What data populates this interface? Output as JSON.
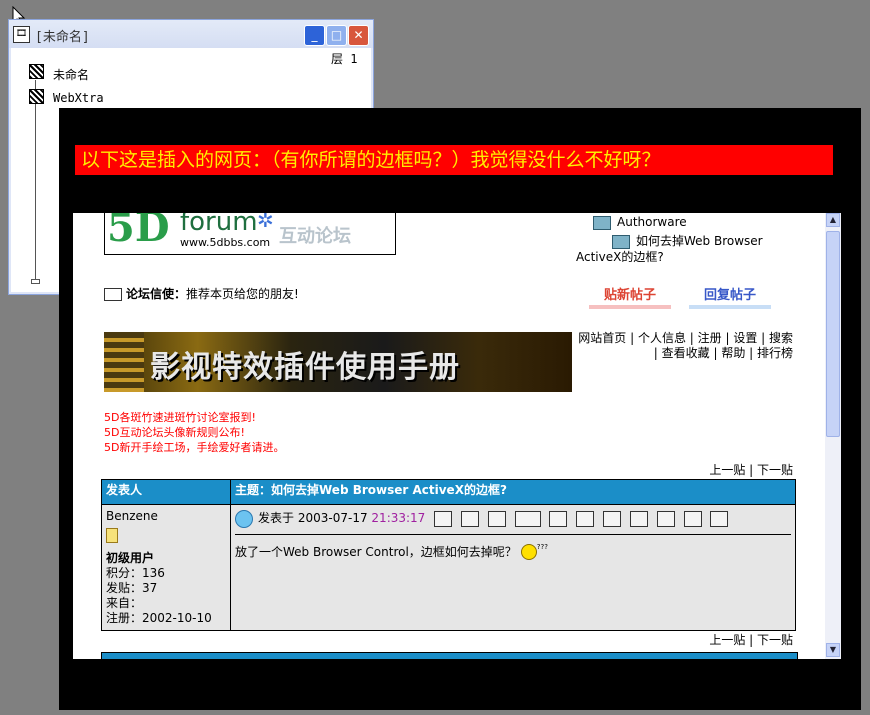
{
  "colors": {
    "desktop": "#808080",
    "banner_bg": "#ff0000",
    "banner_text": "#ffef00",
    "table_header": "#1b8ec8",
    "post_time": "#a020a0"
  },
  "small_window": {
    "title": "[未命名]",
    "app_icon": "director-icon",
    "layer_label": "层 1",
    "nodes": [
      {
        "label": "未命名",
        "icon": "sprite-node-icon"
      },
      {
        "label": "WebXtra",
        "icon": "xtra-node-icon"
      }
    ]
  },
  "banner": {
    "text": "以下这是插入的网页：（有你所谓的边框吗？）我觉得没什么不好呀？"
  },
  "forum": {
    "logo": {
      "brand": "5D",
      "word": "forum",
      "url": "www.5dbbs.com",
      "tagline": "互动论坛"
    },
    "breadcrumb": [
      {
        "label": "Authorware"
      },
      {
        "label": "如何去掉Web Browser ActiveX的边框?"
      }
    ],
    "messenger": {
      "label": "论坛信使：",
      "text": "推荐本页给您的朋友!"
    },
    "buttons": {
      "new_post": "贴新帖子",
      "reply": "回复帖子"
    },
    "ad_banner_text": "影视特效插件使用手册",
    "nav_links": "网站首页 | 个人信息 | 注册 | 设置 | 搜索 | 查看收藏 | 帮助 | 排行榜",
    "notices": [
      "5D各斑竹速进斑竹讨论室报到!",
      "5D互动论坛头像新规则公布!",
      "5D新开手绘工场，手绘爱好者请进。"
    ],
    "prev_next": "上一贴 | 下一贴",
    "table": {
      "col_author": "发表人",
      "col_subject": "主题：如何去掉Web Browser ActiveX的边框?"
    },
    "post": {
      "author": "Benzene",
      "rank": "初级用户",
      "points": "积分：136",
      "posts": "发贴：37",
      "from": "来自：",
      "registered": "注册：2002-10-10",
      "posted_prefix": "发表于",
      "date": "2003-07-17",
      "time": "21:33:17",
      "message": "放了一个Web Browser Control，边框如何去掉呢？",
      "emoticon_text": "???"
    }
  }
}
